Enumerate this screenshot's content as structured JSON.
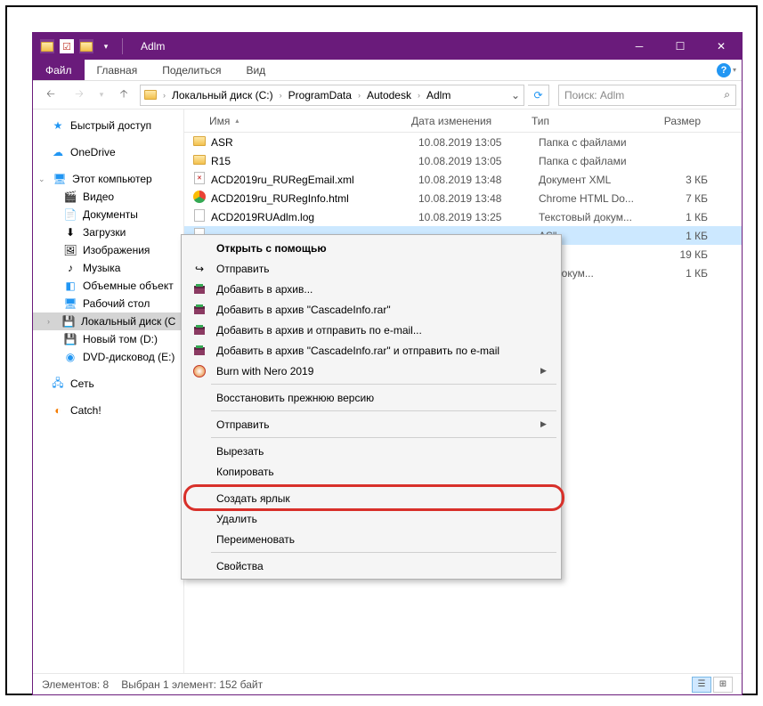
{
  "title": "Adlm",
  "ribbon": {
    "file": "Файл",
    "home": "Главная",
    "share": "Поделиться",
    "view": "Вид"
  },
  "path": {
    "segs": [
      "Локальный диск (C:)",
      "ProgramData",
      "Autodesk",
      "Adlm"
    ]
  },
  "search": {
    "placeholder": "Поиск: Adlm"
  },
  "sidebar": {
    "quick": "Быстрый доступ",
    "onedrive": "OneDrive",
    "thispc": "Этот компьютер",
    "video": "Видео",
    "docs": "Документы",
    "downloads": "Загрузки",
    "pictures": "Изображения",
    "music": "Музыка",
    "objects3d": "Объемные объект",
    "desktop": "Рабочий стол",
    "localc": "Локальный диск (C",
    "newvol": "Новый том (D:)",
    "dvd": "DVD-дисковод (E:)",
    "network": "Сеть",
    "catch": "Catch!"
  },
  "cols": {
    "name": "Имя",
    "date": "Дата изменения",
    "type": "Тип",
    "size": "Размер"
  },
  "files": [
    {
      "ico": "folder",
      "name": "ASR",
      "date": "10.08.2019 13:05",
      "type": "Папка с файлами",
      "size": ""
    },
    {
      "ico": "folder",
      "name": "R15",
      "date": "10.08.2019 13:05",
      "type": "Папка с файлами",
      "size": ""
    },
    {
      "ico": "xml",
      "name": "ACD2019ru_RURegEmail.xml",
      "date": "10.08.2019 13:48",
      "type": "Документ XML",
      "size": "3 КБ"
    },
    {
      "ico": "chrome",
      "name": "ACD2019ru_RURegInfo.html",
      "date": "10.08.2019 13:48",
      "type": "Chrome HTML Do...",
      "size": "7 КБ"
    },
    {
      "ico": "file",
      "name": "ACD2019RUAdlm.log",
      "date": "10.08.2019 13:25",
      "type": "Текстовый докум...",
      "size": "1 КБ"
    },
    {
      "ico": "file",
      "name": "",
      "date": "",
      "type": "AS\"",
      "size": "1 КБ",
      "sel": true
    },
    {
      "ico": "file",
      "name": "",
      "date": "",
      "type": "T\"",
      "size": "19 КБ"
    },
    {
      "ico": "file",
      "name": "",
      "date": "",
      "type": "ый докум...",
      "size": "1 КБ"
    }
  ],
  "ctx": {
    "openwith": "Открыть с помощью",
    "send": "Отправить",
    "addarchive": "Добавить в архив...",
    "addcascade": "Добавить в архив \"CascadeInfo.rar\"",
    "addemail": "Добавить в архив и отправить по e-mail...",
    "addcascadeemail": "Добавить в архив \"CascadeInfo.rar\" и отправить по e-mail",
    "nero": "Burn with Nero 2019",
    "restore": "Восстановить прежнюю версию",
    "sendto": "Отправить",
    "cut": "Вырезать",
    "copy": "Копировать",
    "shortcut": "Создать ярлык",
    "delete": "Удалить",
    "rename": "Переименовать",
    "props": "Свойства"
  },
  "status": {
    "items": "Элементов: 8",
    "selected": "Выбран 1 элемент: 152 байт"
  }
}
